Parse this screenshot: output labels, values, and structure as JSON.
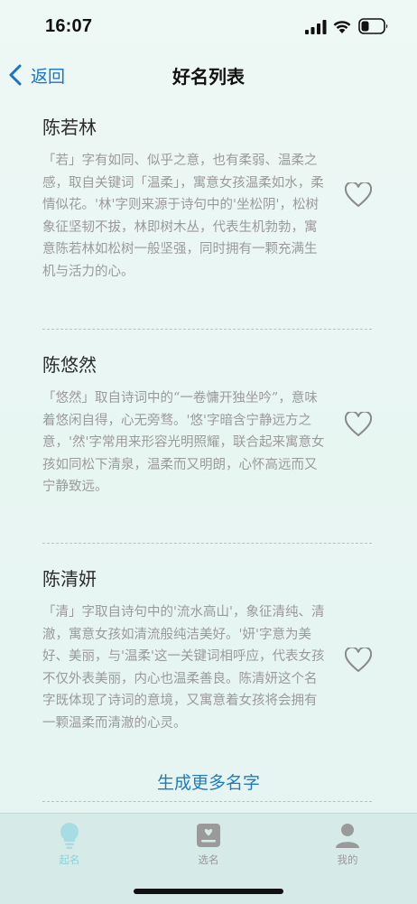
{
  "status_bar": {
    "time": "16:07",
    "signal_icon": "cellular-signal-icon",
    "wifi_icon": "wifi-icon",
    "battery_icon": "battery-icon",
    "battery_level": 0.3
  },
  "nav": {
    "back_label": "返回",
    "title": "好名列表"
  },
  "names": [
    {
      "name": "陈若林",
      "description": "「若」字有如同、似乎之意，也有柔弱、温柔之感，取自关键词「温柔」，寓意女孩温柔如水，柔情似花。'林'字则来源于诗句中的'坐松阴'，松树象征坚韧不拔，林即树木丛，代表生机勃勃，寓意陈若林如松树一般坚强，同时拥有一颗充满生机与活力的心。",
      "favorite": false
    },
    {
      "name": "陈悠然",
      "description": "「悠然」取自诗词中的“一卷慵开独坐吟”，意味着悠闲自得，心无旁骛。'悠'字暗含宁静远方之意，'然'字常用来形容光明照耀，联合起来寓意女孩如同松下清泉，温柔而又明朗，心怀高远而又宁静致远。",
      "favorite": false
    },
    {
      "name": "陈清妍",
      "description": "「清」字取自诗句中的'流水高山'，象征清纯、清澈，寓意女孩如清流般纯洁美好。'妍'字意为美好、美丽，与'温柔'这一关键词相呼应，代表女孩不仅外表美丽，内心也温柔善良。陈清妍这个名字既体现了诗词的意境，又寓意着女孩将会拥有一颗温柔而清澈的心灵。",
      "favorite": false
    }
  ],
  "more_button": "生成更多名字",
  "tabs": [
    {
      "label": "起名",
      "icon": "lightbulb-icon",
      "active": true
    },
    {
      "label": "选名",
      "icon": "name-card-icon",
      "active": false
    },
    {
      "label": "我的",
      "icon": "person-icon",
      "active": false
    }
  ],
  "colors": {
    "accent": "#1f7dbf",
    "back_blue": "#1a73c8",
    "active_tab": "#8fd0d9",
    "inactive_tab": "#999999",
    "description_text": "#9a9a9a"
  }
}
